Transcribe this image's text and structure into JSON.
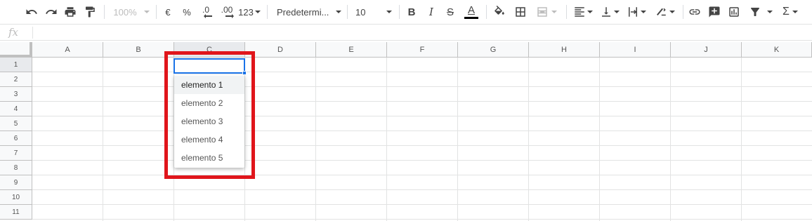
{
  "toolbar": {
    "zoom": "100%",
    "currency": "€",
    "percent": "%",
    "decrease_decimals": ".0",
    "increase_decimals": ".00",
    "number_format": "123",
    "font": "Predetermi...",
    "font_size": "10",
    "bold": "B",
    "italic": "I",
    "strikethrough": "S",
    "text_color": "A",
    "sum": "Σ"
  },
  "formula_bar": {
    "fx_label": "fx",
    "value": ""
  },
  "columns": [
    "A",
    "B",
    "C",
    "D",
    "E",
    "F",
    "G",
    "H",
    "I",
    "J",
    "K"
  ],
  "rows": [
    "1",
    "2",
    "3",
    "4",
    "5",
    "6",
    "7",
    "8",
    "9",
    "10",
    "11"
  ],
  "active_cell": "C1",
  "dropdown": {
    "items": [
      "elemento 1",
      "elemento 2",
      "elemento 3",
      "elemento 4",
      "elemento 5"
    ],
    "hovered": "elemento 1"
  },
  "colors": {
    "highlight": "#e0151b",
    "selection": "#1a73e8",
    "header_bg": "#f8f9fa",
    "gridline": "#e2e3e3"
  }
}
